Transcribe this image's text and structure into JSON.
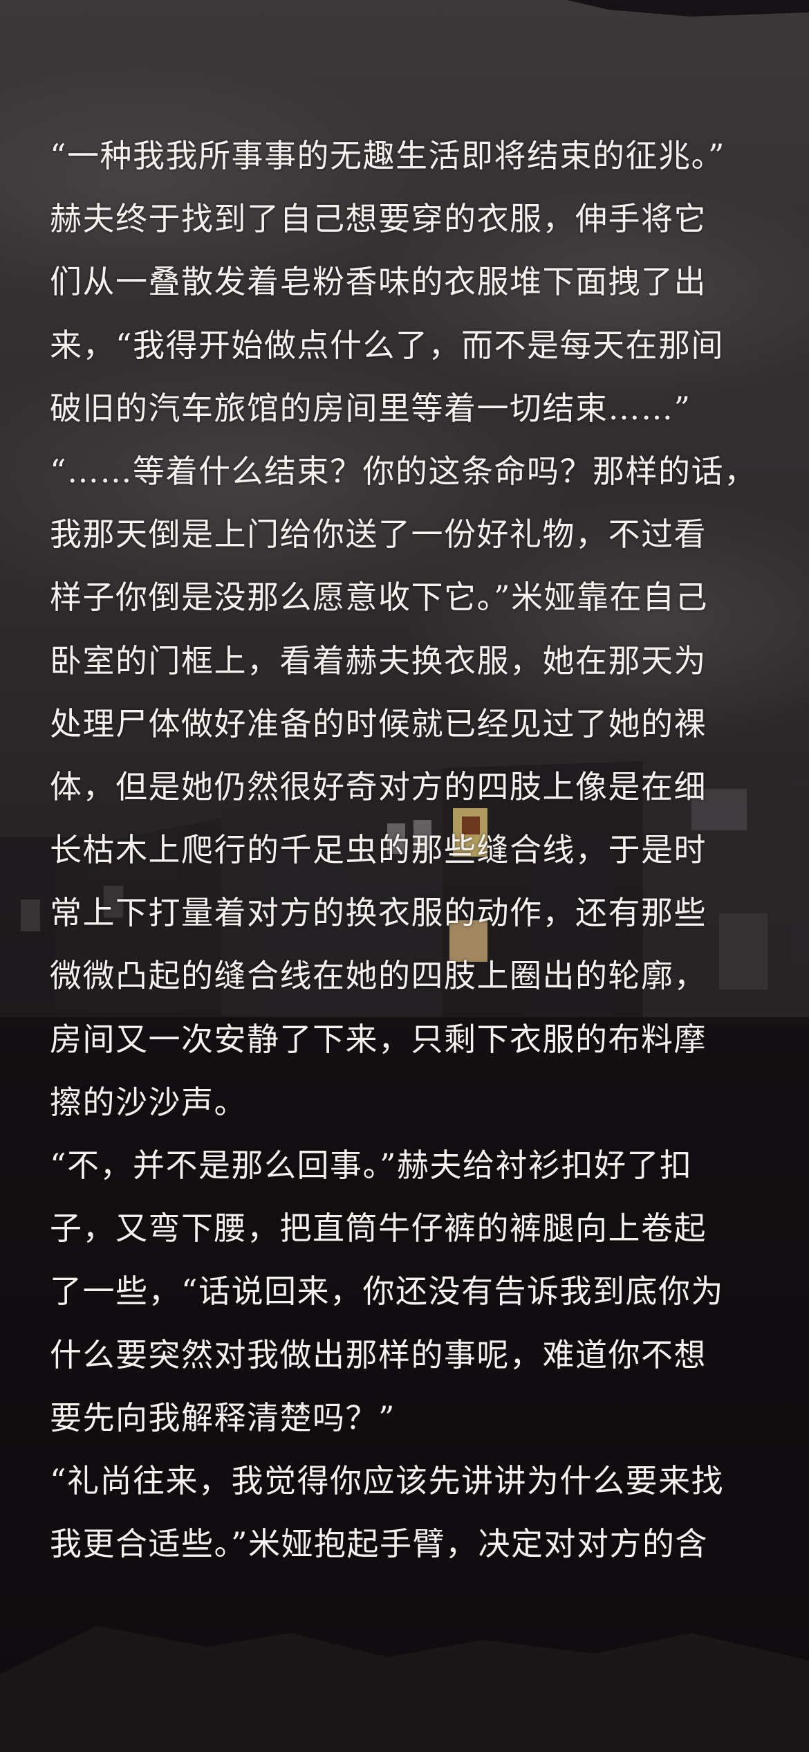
{
  "story": {
    "lines": [
      "“一种我我所事事的无趣生活即将结束的征兆。”",
      "赫夫终于找到了自己想要穿的衣服，伸手将它",
      "们从一叠散发着皂粉香味的衣服堆下面拽了出",
      "来，“我得开始做点什么了，而不是每天在那间",
      "破旧的汽车旅馆的房间里等着一切结束……”",
      "“……等着什么结束？你的这条命吗？那样的话，",
      "我那天倒是上门给你送了一份好礼物，不过看",
      "样子你倒是没那么愿意收下它。”米娅靠在自己",
      "卧室的门框上，看着赫夫换衣服，她在那天为",
      "处理尸体做好准备的时候就已经见过了她的裸",
      "体，但是她仍然很好奇对方的四肢上像是在细",
      "长枯木上爬行的千足虫的那些缝合线，于是时",
      "常上下打量着对方的换衣服的动作，还有那些",
      "微微凸起的缝合线在她的四肢上圈出的轮廓，",
      "房间又一次安静了下来，只剩下衣服的布料摩",
      "擦的沙沙声。",
      "“不，并不是那么回事。”赫夫给衬衫扣好了扣",
      "子，又弯下腰，把直筒牛仔裤的裤腿向上卷起",
      "了一些，“话说回来，你还没有告诉我到底你为",
      "什么要突然对我做出那样的事呢，难道你不想",
      "要先向我解释清楚吗？”",
      "“礼尚往来，我觉得你应该先讲讲为什么要来找",
      "我更合适些。”米娅抱起手臂，决定对对方的含"
    ]
  }
}
